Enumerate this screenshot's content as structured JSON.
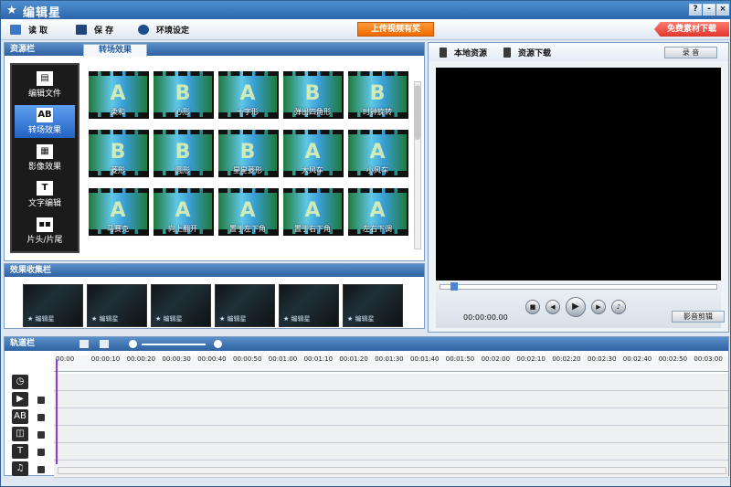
{
  "app": {
    "title": "编辑星"
  },
  "window": {
    "help": "?",
    "minimize": "-",
    "close": "×"
  },
  "toolbar": {
    "open": "读 取",
    "save": "保 存",
    "settings": "环境设定",
    "upload": "上传视频有奖",
    "free_download": "免费素材下载"
  },
  "resource": {
    "header": "资源栏",
    "tab": "转场效果",
    "categories": [
      "编辑文件",
      "转场效果",
      "影像效果",
      "文字编辑",
      "片头/片尾"
    ],
    "thumbnails": [
      "柔和",
      "心形",
      "十字形",
      "弹出四角形",
      "时钟旋转",
      "菱形",
      "圆形",
      "星星菱形",
      "大风车",
      "小风车",
      "马赛克",
      "向上翻开",
      "置于左下角",
      "置于右下角",
      "左右下调"
    ]
  },
  "effects": {
    "header": "效果收集栏",
    "items": [
      "编辑星",
      "编辑星",
      "编辑星",
      "编辑星",
      "编辑星",
      "编辑星"
    ]
  },
  "preview": {
    "local": "本地资源",
    "download": "资源下载",
    "record": "录 音",
    "time": "00:00:00.00",
    "cut": "影音剪辑"
  },
  "track": {
    "header": "轨道栏",
    "ticks": [
      "00:00",
      "00:00:10",
      "00:00:20",
      "00:00:30",
      "00:00:40",
      "00:00:50",
      "00:01:00",
      "00:01:10",
      "00:01:20",
      "00:01:30",
      "00:01:40",
      "00:01:50",
      "00:02:00",
      "00:02:10",
      "00:02:20",
      "00:02:30",
      "00:02:40",
      "00:02:50",
      "00:03:00"
    ],
    "lanes": [
      "clock-icon",
      "video-icon",
      "transition-icon",
      "effect-icon",
      "text-icon",
      "music-icon"
    ]
  },
  "colors": {
    "accent": "#2e62a2",
    "upload": "#ee6a00",
    "free": "#e0362c",
    "playhead": "#8a3fd0"
  }
}
